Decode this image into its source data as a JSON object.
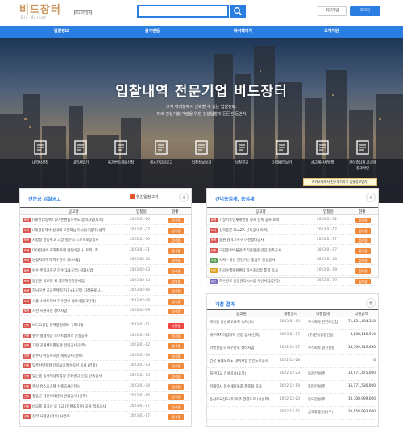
{
  "header": {
    "logo_main": "비드장터",
    "logo_sub": "Bid Market",
    "logo_badge": "SSL보안접속",
    "search_placeholder": "",
    "join": "회원가입",
    "login": "로그인"
  },
  "nav": [
    "입찰정보",
    "물가변동",
    "마이페이지",
    "고객지원"
  ],
  "hero": {
    "title": "입찰내역 전문기업 비드장터",
    "sub1": "고객 여러분께서 신뢰할 수 있는 입찰정보,",
    "sub2": "미래 건설기술 개발을 위한 건설입찰의 든든한 동반자"
  },
  "quick": [
    {
      "label": "내역서신청",
      "icon": "document-icon"
    },
    {
      "label": "내역서받기",
      "icon": "download-icon"
    },
    {
      "label": "물가변동검토신청",
      "icon": "chart-doc-icon"
    },
    {
      "label": "실시간입찰공고",
      "icon": "monitor-icon"
    },
    {
      "label": "입찰정보보기",
      "icon": "calendar-icon"
    },
    {
      "label": "낙찰결과",
      "icon": "edit-icon"
    },
    {
      "label": "거래내역보기",
      "icon": "list-icon"
    },
    {
      "label": "세금계산서발행",
      "icon": "receipt-icon"
    },
    {
      "label": "간이종심제,종심제",
      "label2": "결과확인",
      "icon": "result-icon"
    }
  ],
  "left_panel": {
    "title": "전문공 입찰공고",
    "tab2": "월간입정보기",
    "headers": [
      "공고명",
      "입찰일",
      "현황"
    ],
    "rows": [
      {
        "tag": "토목",
        "title": "(재)반(2등록) 농어촌편춤하수도 정비사업(토목)",
        "date": "2023-01-20",
        "status": "접수중"
      },
      {
        "tag": "토목",
        "title": "(재)광등재서 실내외 고원화능지시설(3입지) 설치",
        "date": "2023-01-27",
        "status": "접수중"
      },
      {
        "tag": "토목",
        "title": "차량정 강동추고 고상-실무시 드로목포장공사",
        "date": "2023-01-30",
        "status": "접수중"
      },
      {
        "tag": "토목",
        "title": "대야한관로 지하추가제 간정비공사 (토목, 조...",
        "date": "2023-01-31",
        "status": "접수중"
      },
      {
        "tag": "토목",
        "title": "남림저리주역 하수관로 정비사업",
        "date": "2023-02-02",
        "status": "접수중"
      },
      {
        "tag": "토목",
        "title": "아수 주입기지구 하수(1/1구역) 정화사업",
        "date": "2023-02-03",
        "status": "접수중"
      },
      {
        "tag": "토목",
        "title": "동인군 비교천 외 생태하천복원사업",
        "date": "2023-02-03",
        "status": "접수중"
      },
      {
        "tag": "토목",
        "title": "하남군산 공공주택지구(1+1구역) 지정물류시...",
        "date": "2023-02-06",
        "status": "접수중"
      },
      {
        "tag": "토목",
        "title": "사흥 스마트허브 하수관로 정비사업(3단계)",
        "date": "2023-02-08",
        "status": "접수중"
      },
      {
        "tag": "토목",
        "title": "지천 지원하천 정비사업",
        "date": "2023-02-09",
        "status": "접수중"
      }
    ],
    "rows2": [
      {
        "tag": "건축",
        "title": "비드요광장 인력양성센터 구축사업",
        "date": "2023-01-11",
        "status": "낙찰중"
      },
      {
        "tag": "건축",
        "title": "별무 평생학습 스마트캠퍼스 건설공사",
        "date": "2023-01-12",
        "status": "접수중"
      },
      {
        "tag": "건축",
        "title": "기천 공원체육활동관 건립공사(건축)",
        "date": "2023-01-12",
        "status": "접수중"
      },
      {
        "tag": "건축",
        "title": "강주시 아동복지관 개축공사(건축)",
        "date": "2023-01-13",
        "status": "접수중"
      },
      {
        "tag": "건축",
        "title": "맞주산단복합 단지보호특수공원 공사 (건축)",
        "date": "2023-01-13",
        "status": "접수중"
      },
      {
        "tag": "건축",
        "title": "맞는중 동사재생복합형 문화센터 건립 신축공사",
        "date": "2023-01-13",
        "status": "접수중"
      },
      {
        "tag": "건축",
        "title": "주상 유스호스텔 신축공사(건축)",
        "date": "2023-01-14",
        "status": "접수중"
      },
      {
        "tag": "건축",
        "title": "청동군 국민체육센터 건립공사 (건축)",
        "date": "2023-01-16",
        "status": "접수중"
      },
      {
        "tag": "건축",
        "title": "비오를 외국산 로 1급 (전원조치원) 공사 적용공사",
        "date": "2023-01-17",
        "status": "접수중"
      },
      {
        "tag": "건축",
        "title": "전라 사형건(건축) 사업이 ...",
        "date": "2023-01-17",
        "status": "접수중"
      }
    ]
  },
  "right_panel": {
    "title": "간이종심제, 종심제",
    "popup": "카카오톡에서 친구추가하고 입찰정보받기!",
    "headers": [
      "공고명",
      "입찰일",
      "현황"
    ],
    "rows": [
      {
        "tag": "토목",
        "title": "기상기후인재개발원 청사 신축 공사(토목)",
        "date": "2023-01-12",
        "status": "접수중"
      },
      {
        "tag": "토목",
        "title": "신북중문 PLAZA 신축공사(토목)",
        "date": "2023-01-17",
        "status": "접수중"
      },
      {
        "tag": "토목",
        "title": "중원 감지고지구 하천정비공사",
        "date": "2023-01-17",
        "status": "접수중"
      },
      {
        "tag": "건축",
        "title": "국립중주박물관 조리관광관 건립 건축공사",
        "date": "2023-01-17",
        "status": "접수중"
      },
      {
        "tag": "조경",
        "title": "사자 - 외산 전면가는 중심지 건설공사",
        "date": "2023-01-18",
        "status": "접수중"
      },
      {
        "tag": "전기",
        "title": "진공수질복원센터 하수처리장 통합 공사",
        "date": "2023-01-19",
        "status": "접수중"
      },
      {
        "tag": "통신",
        "title": "하수관로 중장관리시스템 개선사업(전력)",
        "date": "2023-01-19",
        "status": "접수중"
      }
    ]
  },
  "result_panel": {
    "title": "개찰 결과",
    "headers": [
      "공고명",
      "개찰일시",
      "낙찰업체",
      "낙찰금액"
    ],
    "rows": [
      {
        "title": "북아동 유선교로표지 숙지(교)",
        "date": "2023-01-09",
        "company": "주식회사 한빈토건업",
        "amount": "71,821,434,350"
      },
      {
        "title": "세주자차이업대학 건립 공사(건축)",
        "date": "2023-01-07",
        "company": "(주)한동종합건설",
        "amount": "8,898,140,910"
      },
      {
        "title": "아쌍선동구 하수관로 정비사업",
        "date": "2022-12-27",
        "company": "주식회사 일신건설",
        "amount": "18,569,316,490"
      },
      {
        "title": "건강 둘레도미노 대미시형 안전도로공사",
        "date": "2022-12-28",
        "company": "",
        "amount": "0"
      },
      {
        "title": "화천대교 건설공사(토목)",
        "date": "2022-12-23",
        "company": "동운건설(주)",
        "amount": "13,971,475,000"
      },
      {
        "title": "김해역사 동수해방물품 풍중화 공사",
        "date": "2022-12-19",
        "company": "풍만건설(주)",
        "amount": "16,171,530,000"
      },
      {
        "title": "동산주요상도(초)북부 연결도로 (시설부)",
        "date": "2022-12-20",
        "company": "동도건설(주)",
        "amount": "10,708,999,000"
      },
      {
        "title": "...",
        "date": "2022-12-15",
        "company": "금호종합건설(주)",
        "amount": "10,058,993,000"
      }
    ]
  },
  "colors": {
    "brand": "#2a7de1",
    "tag_civil": "#d9534f",
    "tag_build": "#d9534f",
    "status": "#f0893a"
  }
}
